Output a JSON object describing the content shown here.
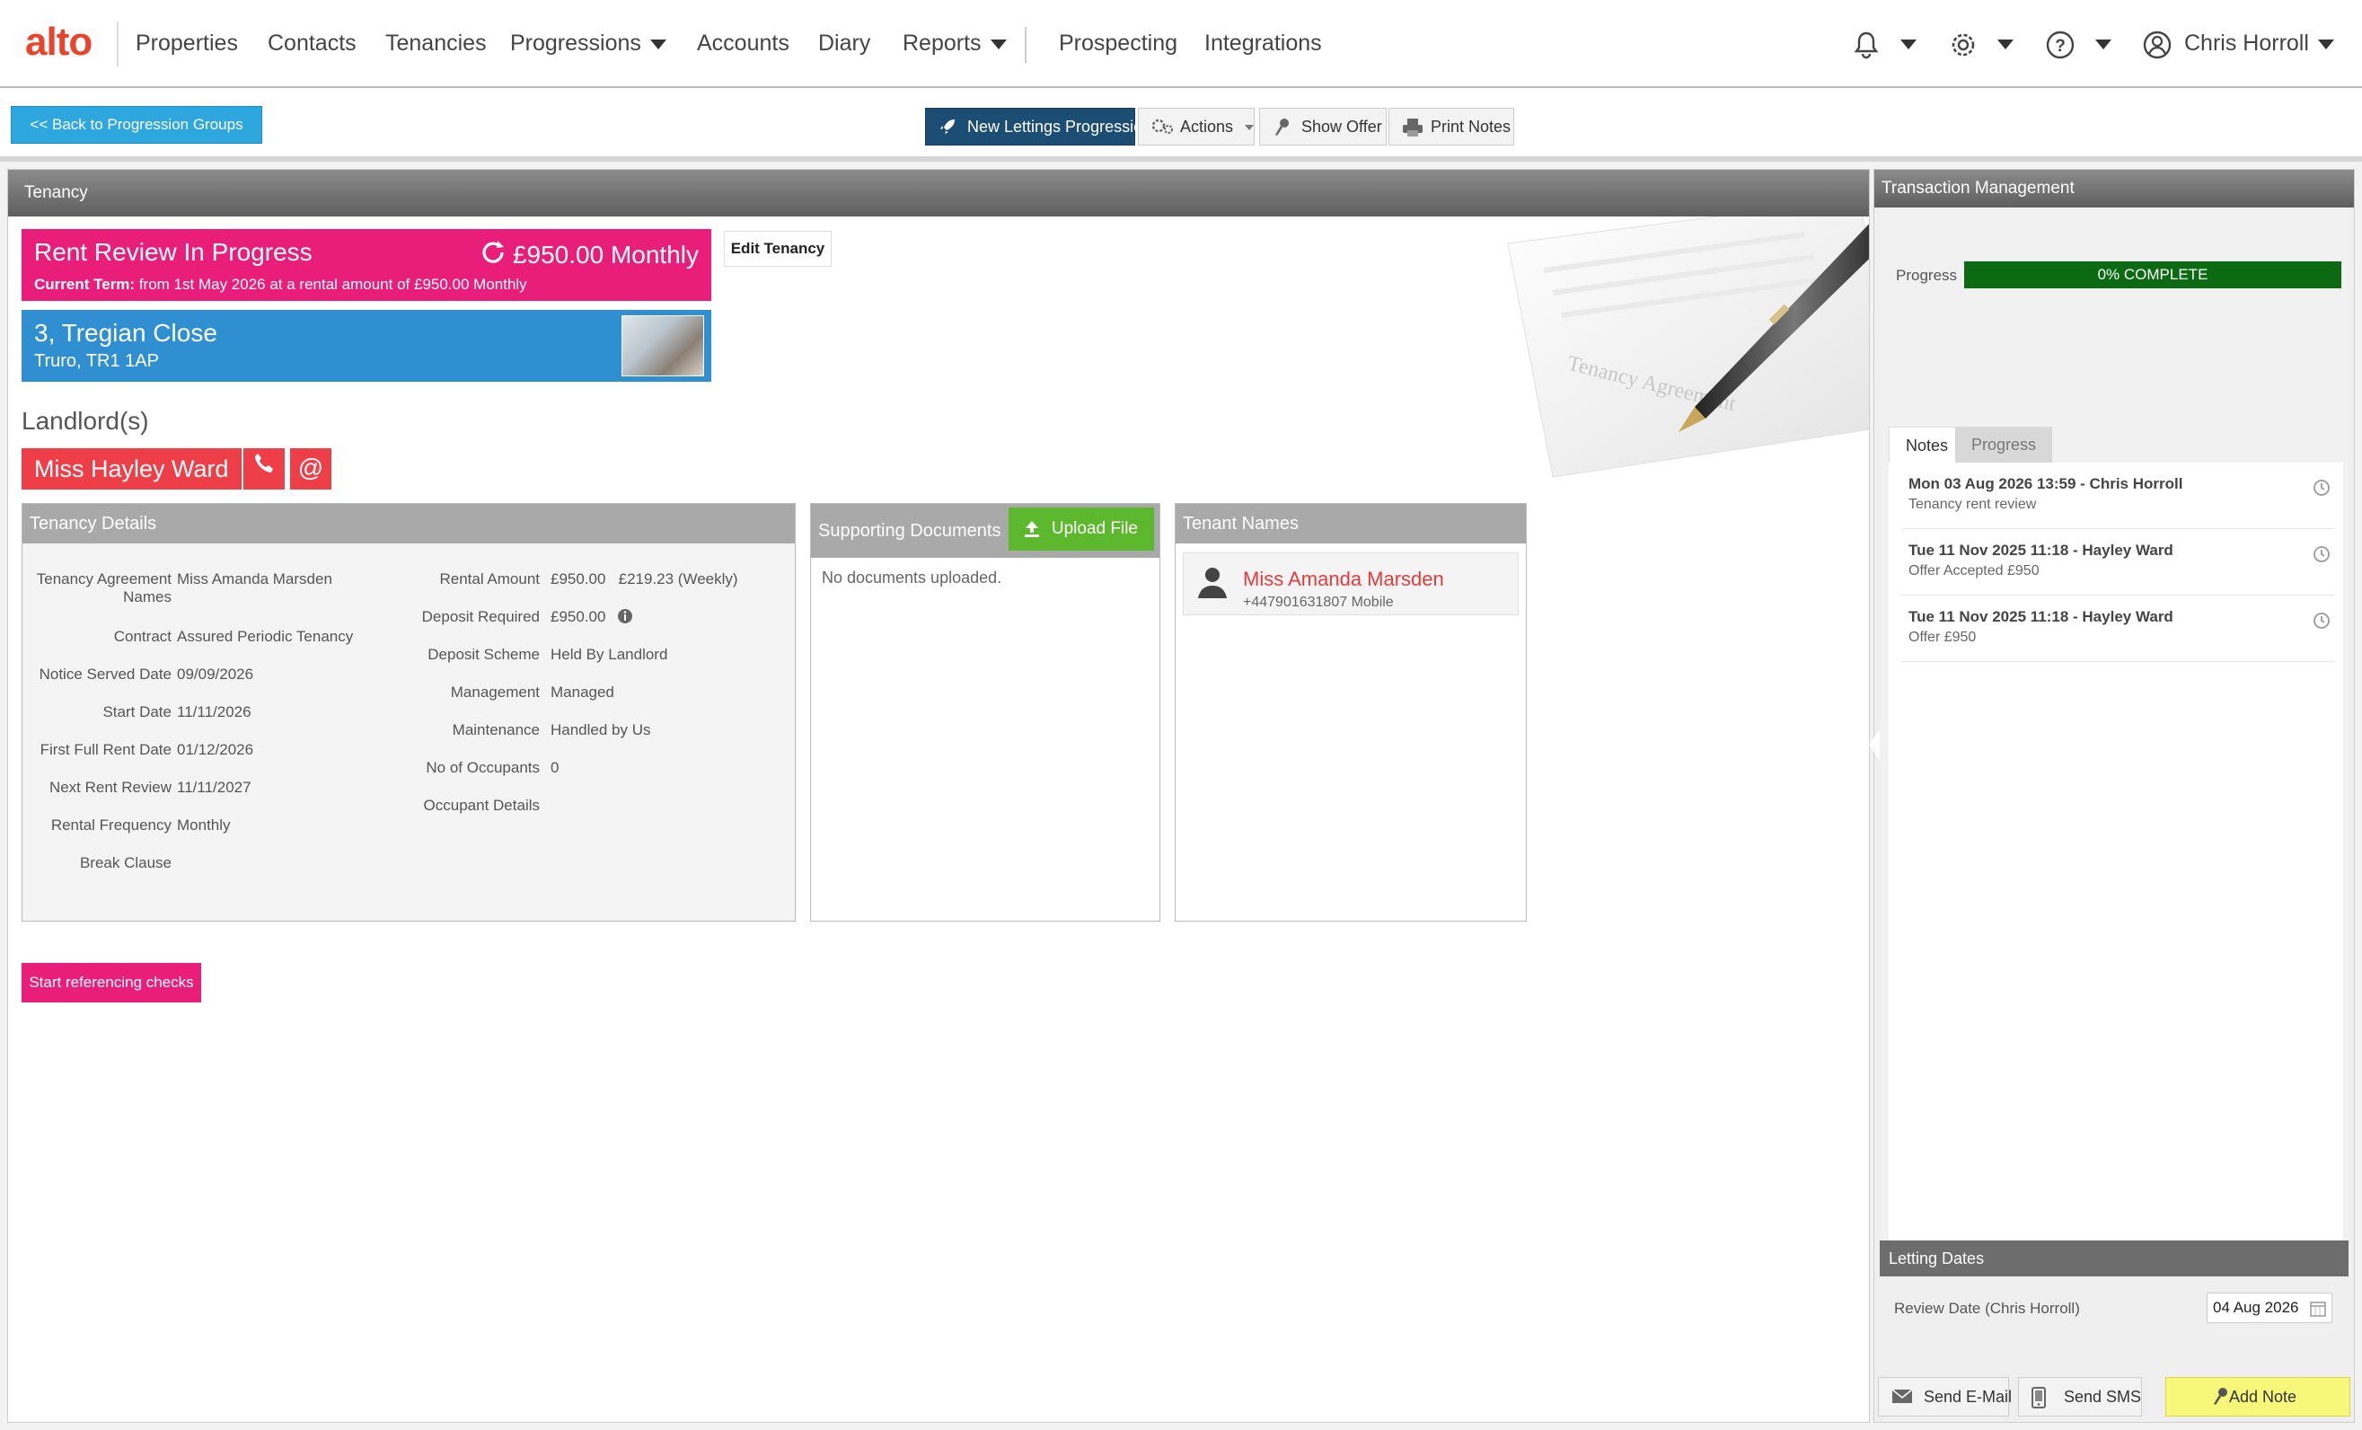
{
  "app": {
    "logo": "alto"
  },
  "nav": {
    "items": [
      "Properties",
      "Contacts",
      "Tenancies",
      "Progressions",
      "Accounts",
      "Diary",
      "Reports",
      "Prospecting",
      "Integrations"
    ],
    "user_name": "Chris Horroll"
  },
  "toolbar": {
    "back_label": "<< Back to Progression Groups",
    "new_progression_label": "New Lettings Progression",
    "actions_label": "Actions",
    "show_offer_label": "Show Offer",
    "print_notes_label": "Print Notes"
  },
  "tenancy": {
    "panel_title": "Tenancy",
    "status_title": "Rent Review In Progress",
    "rent_amount": "£950.00 Monthly",
    "current_term_label": "Current Term:",
    "current_term_text": "from 1st May 2026 at a rental amount of £950.00 Monthly",
    "edit_label": "Edit Tenancy",
    "address_line1": "3, Tregian Close",
    "address_line2": "Truro, TR1 1AP",
    "watermark": "Tenancy Agreement"
  },
  "landlords": {
    "heading": "Landlord(s)",
    "name": "Miss Hayley Ward",
    "email_symbol": "@"
  },
  "details": {
    "title": "Tenancy Details",
    "left": [
      {
        "label": "Tenancy Agreement",
        "label2": "Names",
        "value": "Miss Amanda Marsden"
      },
      {
        "label": "Contract",
        "value": "Assured Periodic Tenancy"
      },
      {
        "label": "Notice Served Date",
        "value": "09/09/2026"
      },
      {
        "label": "Start Date",
        "value": "11/11/2026"
      },
      {
        "label": "First Full Rent Date",
        "value": "01/12/2026"
      },
      {
        "label": "Next Rent Review",
        "value": "11/11/2027"
      },
      {
        "label": "Rental Frequency",
        "value": "Monthly"
      },
      {
        "label": "Break Clause",
        "value": ""
      }
    ],
    "right": [
      {
        "label": "Rental Amount",
        "value": "£950.00",
        "extra": "£219.23 (Weekly)"
      },
      {
        "label": "Deposit Required",
        "value": "£950.00"
      },
      {
        "label": "Deposit Scheme",
        "value": "Held By Landlord"
      },
      {
        "label": "Management",
        "value": "Managed"
      },
      {
        "label": "Maintenance",
        "value": "Handled by Us"
      },
      {
        "label": "No of Occupants",
        "value": "0"
      },
      {
        "label": "Occupant Details",
        "value": ""
      }
    ]
  },
  "documents": {
    "title": "Supporting Documents",
    "upload_label": "Upload File",
    "empty_text": "No documents uploaded."
  },
  "tenants": {
    "title": "Tenant Names",
    "name": "Miss Amanda Marsden",
    "phone": "+447901631807 Mobile"
  },
  "referencing": {
    "button_label": "Start referencing checks"
  },
  "transaction": {
    "title": "Transaction Management",
    "progress_label": "Progress",
    "progress_text": "0% COMPLETE",
    "progress_percent": 0,
    "tabs": [
      "Notes",
      "Progress"
    ],
    "notes": [
      {
        "title": "Mon 03 Aug 2026 13:59 - Chris Horroll",
        "sub": "Tenancy rent review"
      },
      {
        "title": "Tue 11 Nov 2025 11:18 - Hayley Ward",
        "sub": "Offer Accepted £950"
      },
      {
        "title": "Tue 11 Nov 2025 11:18 - Hayley Ward",
        "sub": "Offer £950"
      }
    ]
  },
  "letting_dates": {
    "title": "Letting Dates",
    "review_label": "Review Date (Chris Horroll)",
    "review_date": "04 Aug 2026"
  },
  "bottom_actions": {
    "email_label": "Send E-Mail",
    "sms_label": "Send SMS",
    "note_label": "Add Note"
  },
  "colors": {
    "brand": "#e8442d",
    "pink": "#e91e7a",
    "blue": "#2f8fd0",
    "landlord_red": "#ee3e48",
    "upload_green": "#5cb82c",
    "progress_green": "#0c6a12",
    "primary_navy": "#1c4e73"
  }
}
